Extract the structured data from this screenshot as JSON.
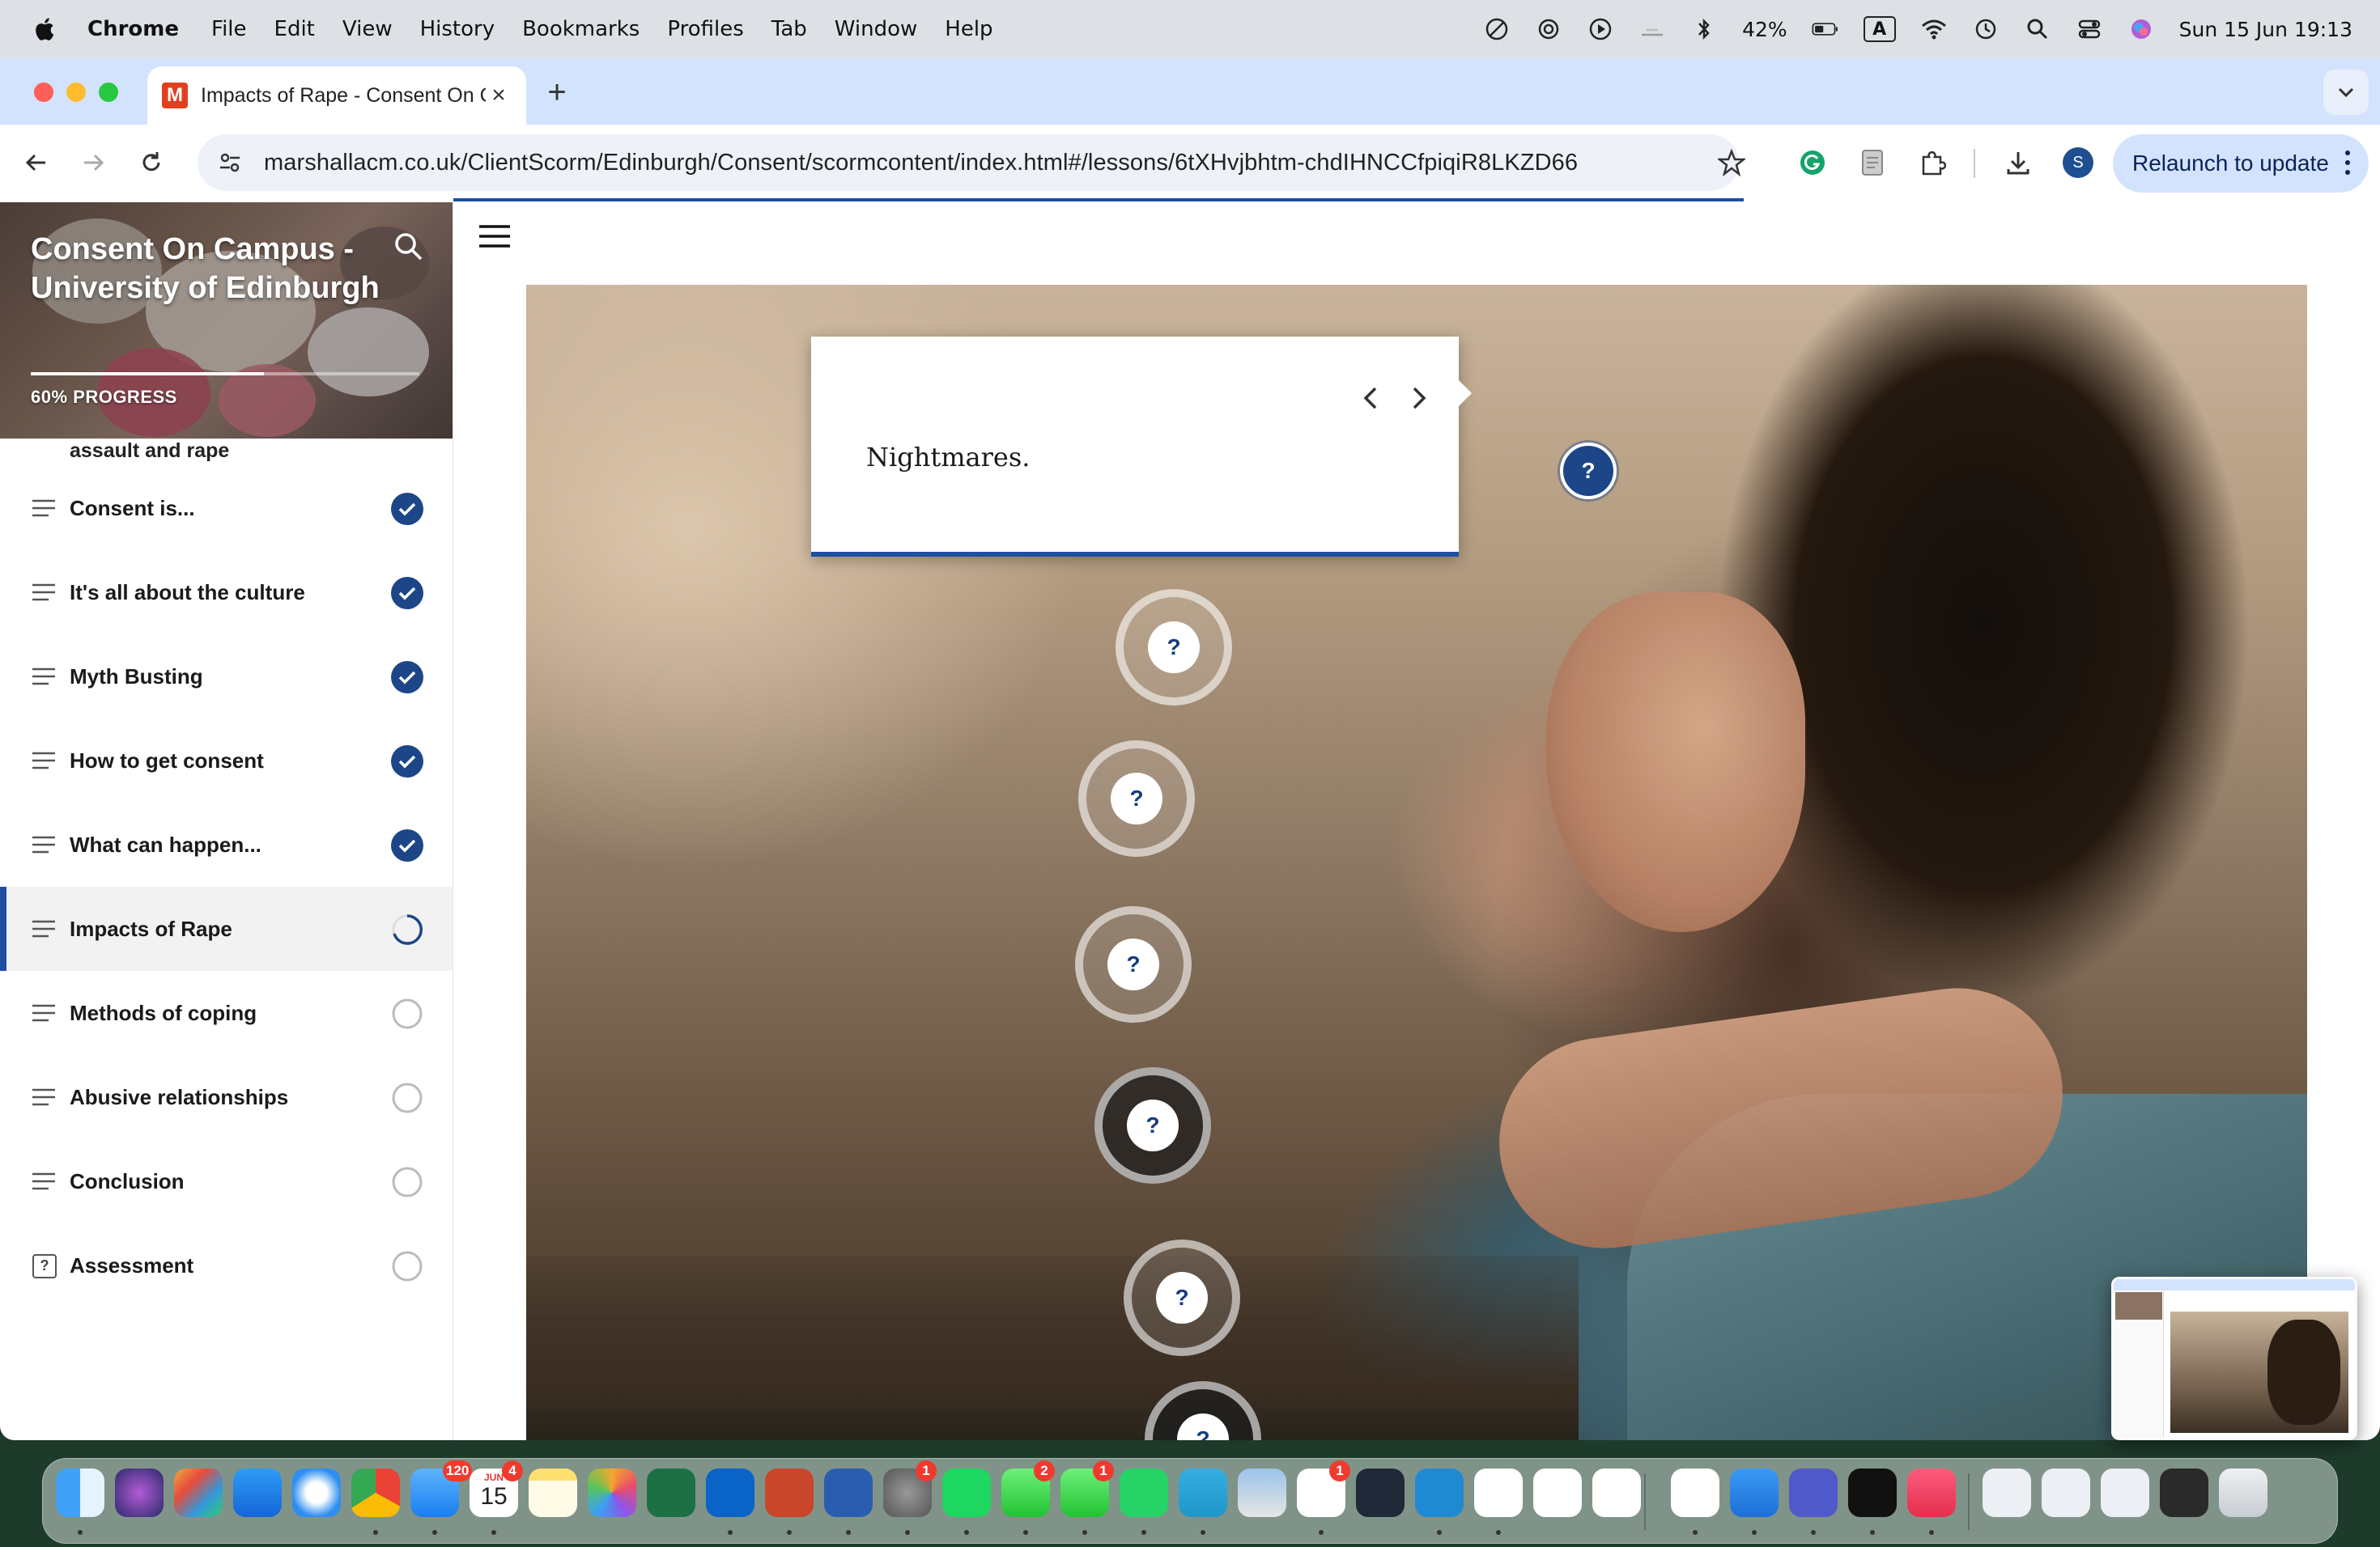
{
  "menubar": {
    "app_name": "Chrome",
    "menus": [
      "File",
      "Edit",
      "View",
      "History",
      "Bookmarks",
      "Profiles",
      "Tab",
      "Window",
      "Help"
    ],
    "battery": "42%",
    "input_source": "A",
    "datetime": "Sun 15 Jun  19:13"
  },
  "browser": {
    "tab_title": "Impacts of Rape - Consent On Campus - University of Edinburgh",
    "tab_favicon": "M",
    "url": "marshallacm.co.uk/ClientScorm/Edinburgh/Consent/scormcontent/index.html#/lessons/6tXHvjbhtm-chdIHNCCfpiqiR8LKZD66",
    "profile_initial": "S",
    "relaunch_label": "Relaunch to update"
  },
  "sidebar": {
    "course_title": "Consent On Campus - University of Edinburgh",
    "progress_label": "60% PROGRESS",
    "progress_value": 0.6,
    "partial_item": "assault and rape",
    "lessons": [
      {
        "label": "Consent is...",
        "status": "complete",
        "icon": "list-lines-icon"
      },
      {
        "label": "It's all about the culture",
        "status": "complete",
        "icon": "list-lines-icon"
      },
      {
        "label": "Myth Busting",
        "status": "complete",
        "icon": "list-lines-icon"
      },
      {
        "label": "How to get consent",
        "status": "complete",
        "icon": "list-lines-icon"
      },
      {
        "label": "What can happen...",
        "status": "complete",
        "icon": "list-lines-icon"
      },
      {
        "label": "Impacts of Rape",
        "status": "in-progress",
        "icon": "list-lines-icon"
      },
      {
        "label": "Methods of coping",
        "status": "not-started",
        "icon": "list-lines-icon"
      },
      {
        "label": "Abusive relationships",
        "status": "not-started",
        "icon": "list-lines-icon"
      },
      {
        "label": "Conclusion",
        "status": "not-started",
        "icon": "list-lines-icon"
      },
      {
        "label": "Assessment",
        "status": "not-started",
        "icon": "quiz-icon"
      }
    ],
    "colors": {
      "accent": "#1e4fa0",
      "check": "#1c4687"
    }
  },
  "main": {
    "popover": {
      "text": "Nightmares."
    },
    "hotspot_symbol": "?",
    "hotspot_count": 7
  },
  "dock": {
    "badges": {
      "mail": "120",
      "calendar": "4",
      "system_settings": "1",
      "messages": "2",
      "facetime": "1",
      "slack": "1"
    },
    "calendar_month": "JUN",
    "calendar_day": "15"
  }
}
